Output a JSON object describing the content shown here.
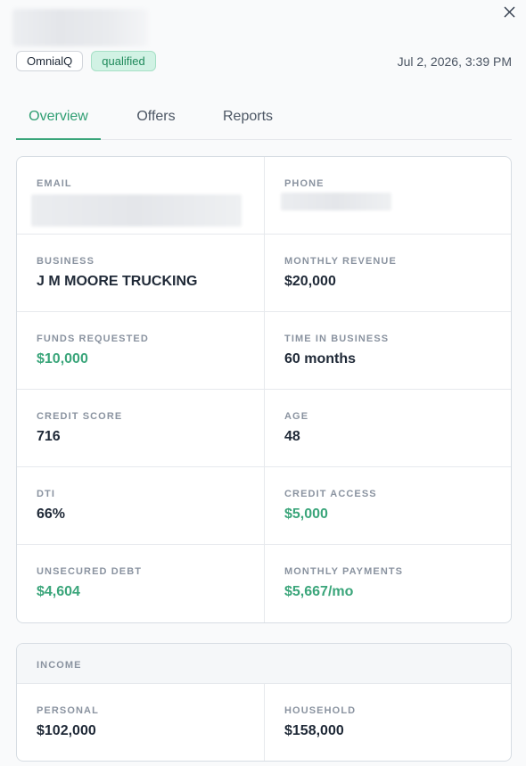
{
  "header": {
    "source_tag": "OmnialQ",
    "status_tag": "qualified",
    "timestamp": "Jul 2, 2026, 3:39 PM",
    "close_icon": "close-icon"
  },
  "tabs": [
    {
      "label": "Overview",
      "active": true
    },
    {
      "label": "Offers",
      "active": false
    },
    {
      "label": "Reports",
      "active": false
    }
  ],
  "details": {
    "email_label": "EMAIL",
    "phone_label": "PHONE",
    "business_label": "BUSINESS",
    "business_value": "J M MOORE TRUCKING",
    "monthly_revenue_label": "MONTHLY REVENUE",
    "monthly_revenue_value": "$20,000",
    "funds_requested_label": "FUNDS REQUESTED",
    "funds_requested_value": "$10,000",
    "time_in_business_label": "TIME IN BUSINESS",
    "time_in_business_value": "60 months",
    "credit_score_label": "CREDIT SCORE",
    "credit_score_value": "716",
    "age_label": "AGE",
    "age_value": "48",
    "dti_label": "DTI",
    "dti_value": "66%",
    "credit_access_label": "CREDIT ACCESS",
    "credit_access_value": "$5,000",
    "unsecured_debt_label": "UNSECURED DEBT",
    "unsecured_debt_value": "$4,604",
    "monthly_payments_label": "MONTHLY PAYMENTS",
    "monthly_payments_value": "$5,667/mo"
  },
  "income": {
    "title": "INCOME",
    "personal_label": "PERSONAL",
    "personal_value": "$102,000",
    "household_label": "HOUSEHOLD",
    "household_value": "$158,000"
  },
  "colors": {
    "accent_green": "#3aa57a",
    "status_bg": "#d1f2e4",
    "label_gray": "#8a93a0"
  }
}
